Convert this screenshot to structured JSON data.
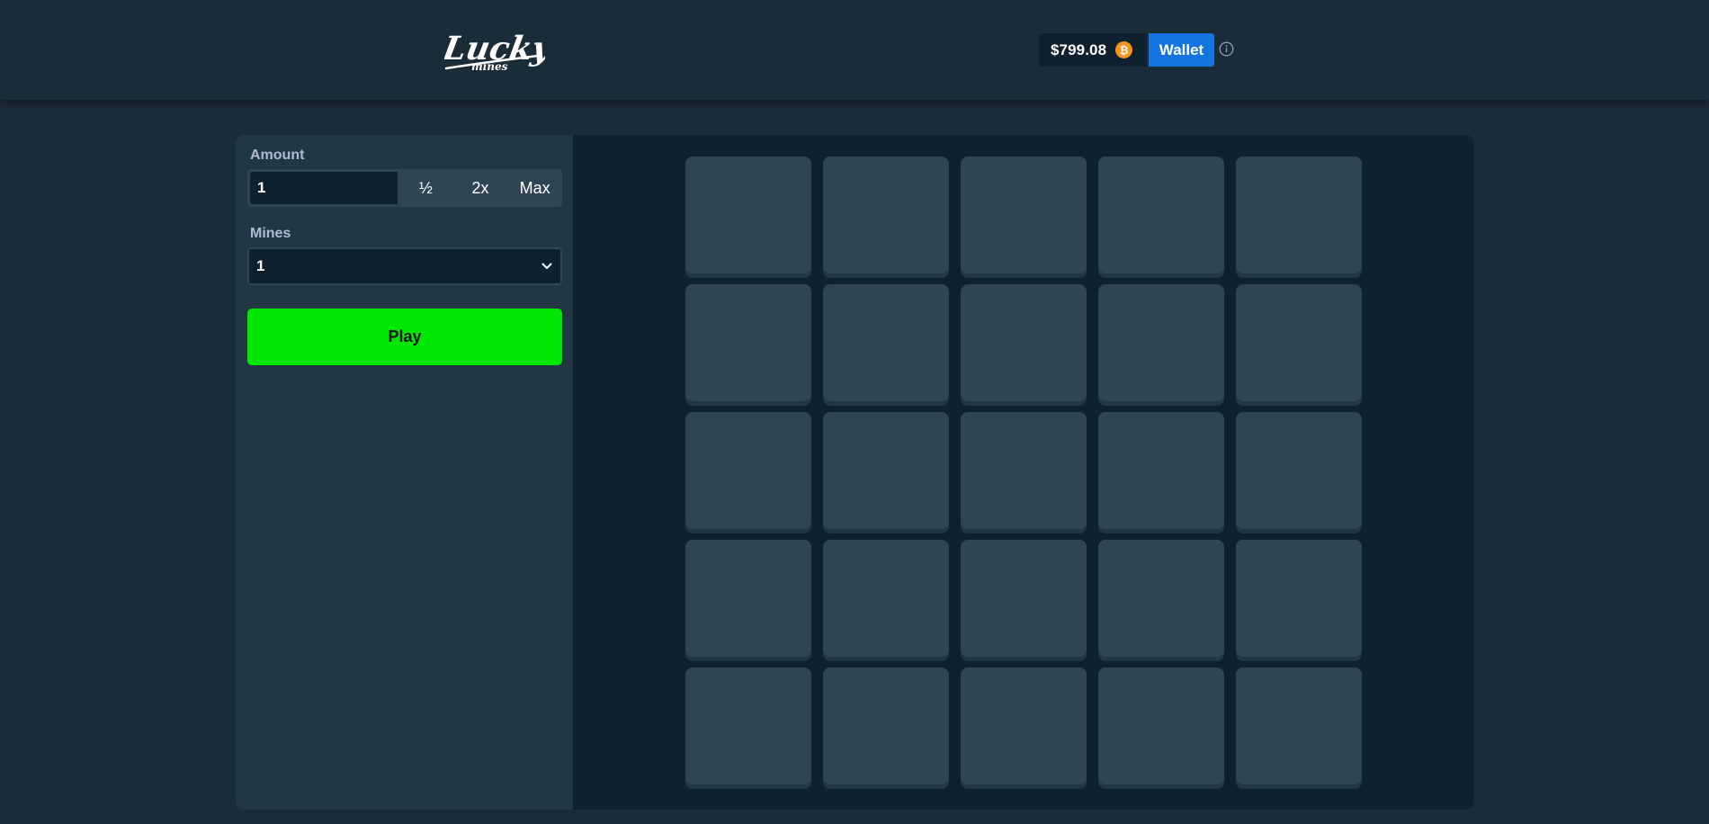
{
  "header": {
    "logo_text": "Lucky",
    "logo_subtext": "mines",
    "balance": "$799.08",
    "currency_icon": "bitcoin-icon",
    "currency_symbol": "₿",
    "wallet_label": "Wallet",
    "info_icon": "info-icon"
  },
  "sidebar": {
    "amount_label": "Amount",
    "amount_value": "1",
    "amount_buttons": [
      "½",
      "2x",
      "Max"
    ],
    "mines_label": "Mines",
    "mines_value": "1",
    "play_label": "Play"
  },
  "board": {
    "rows": 5,
    "cols": 5
  },
  "colors": {
    "background": "#1a2c38",
    "panel": "#213743",
    "board": "#0f212e",
    "tile": "#2f4553",
    "play_button": "#00e701",
    "wallet_button": "#1475e1",
    "bitcoin": "#f7931a"
  }
}
